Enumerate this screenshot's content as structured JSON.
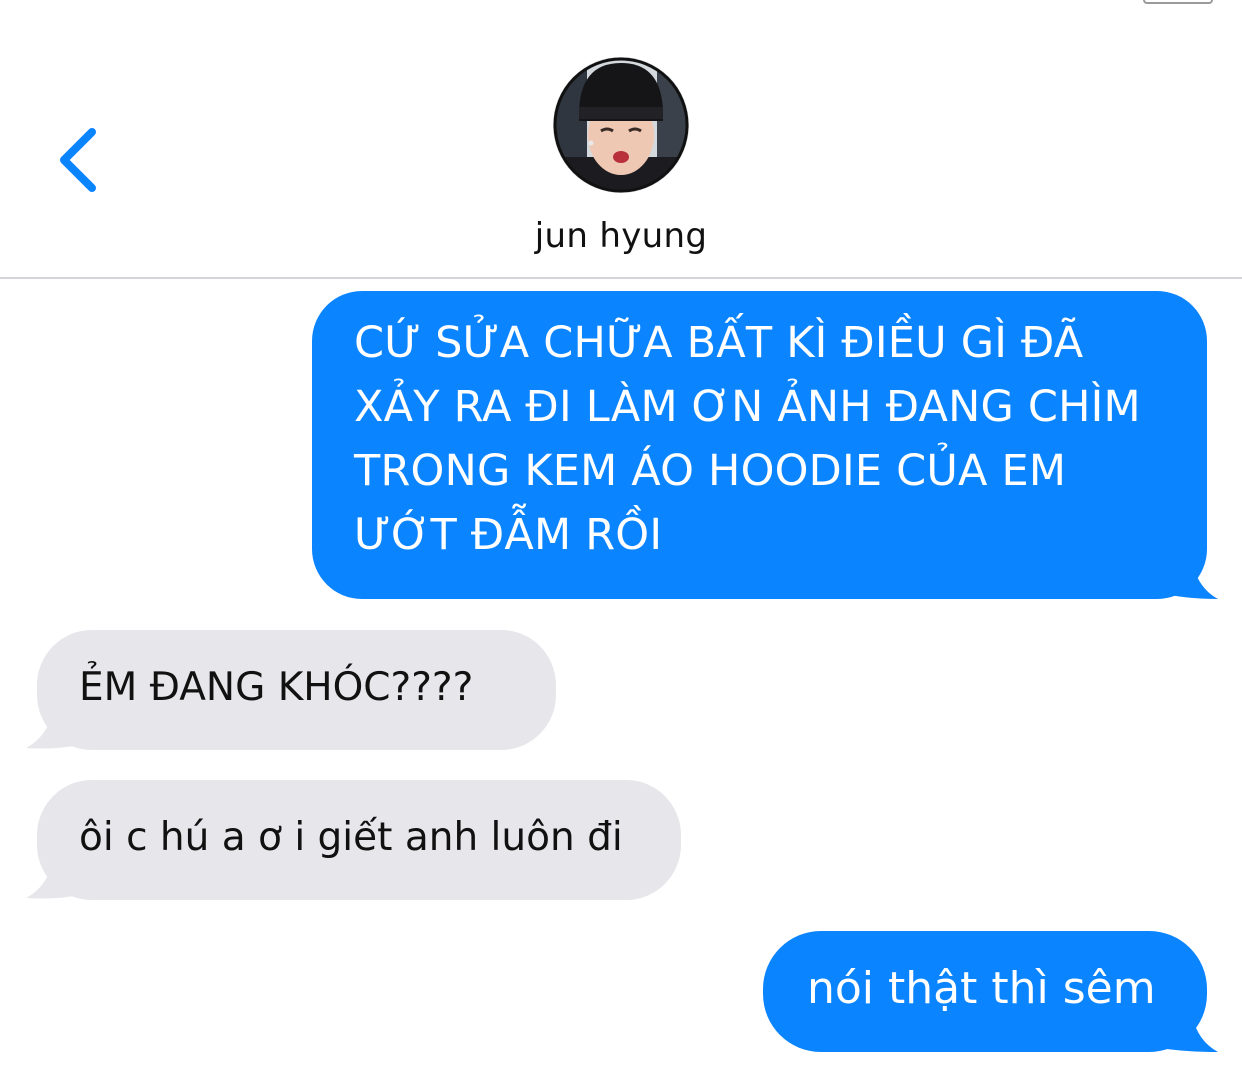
{
  "colors": {
    "sent_bubble": "#0b84ff",
    "received_bubble": "#e6e6eb",
    "accent": "#0b84ff",
    "divider": "#d4d4d8"
  },
  "header": {
    "back_icon": "chevron-left-icon",
    "avatar": "contact-avatar-photo",
    "contact_name": "jun hyung"
  },
  "messages": [
    {
      "direction": "sent",
      "text": "CỨ SỬA CHỮA BẤT KÌ ĐIỀU GÌ ĐÃ\nXẢY RA ĐI LÀM ƠN ẢNH ĐANG CHÌM\nTRONG KEM ÁO HOODIE CỦA EM\nƯỚT ĐẪM RỒI"
    },
    {
      "direction": "received",
      "text": "ẺM ĐANG KHÓC????"
    },
    {
      "direction": "received",
      "text": "ôi c hú a ơ i giết anh luôn đi"
    },
    {
      "direction": "sent",
      "text": "nói thật thì sêm"
    }
  ]
}
